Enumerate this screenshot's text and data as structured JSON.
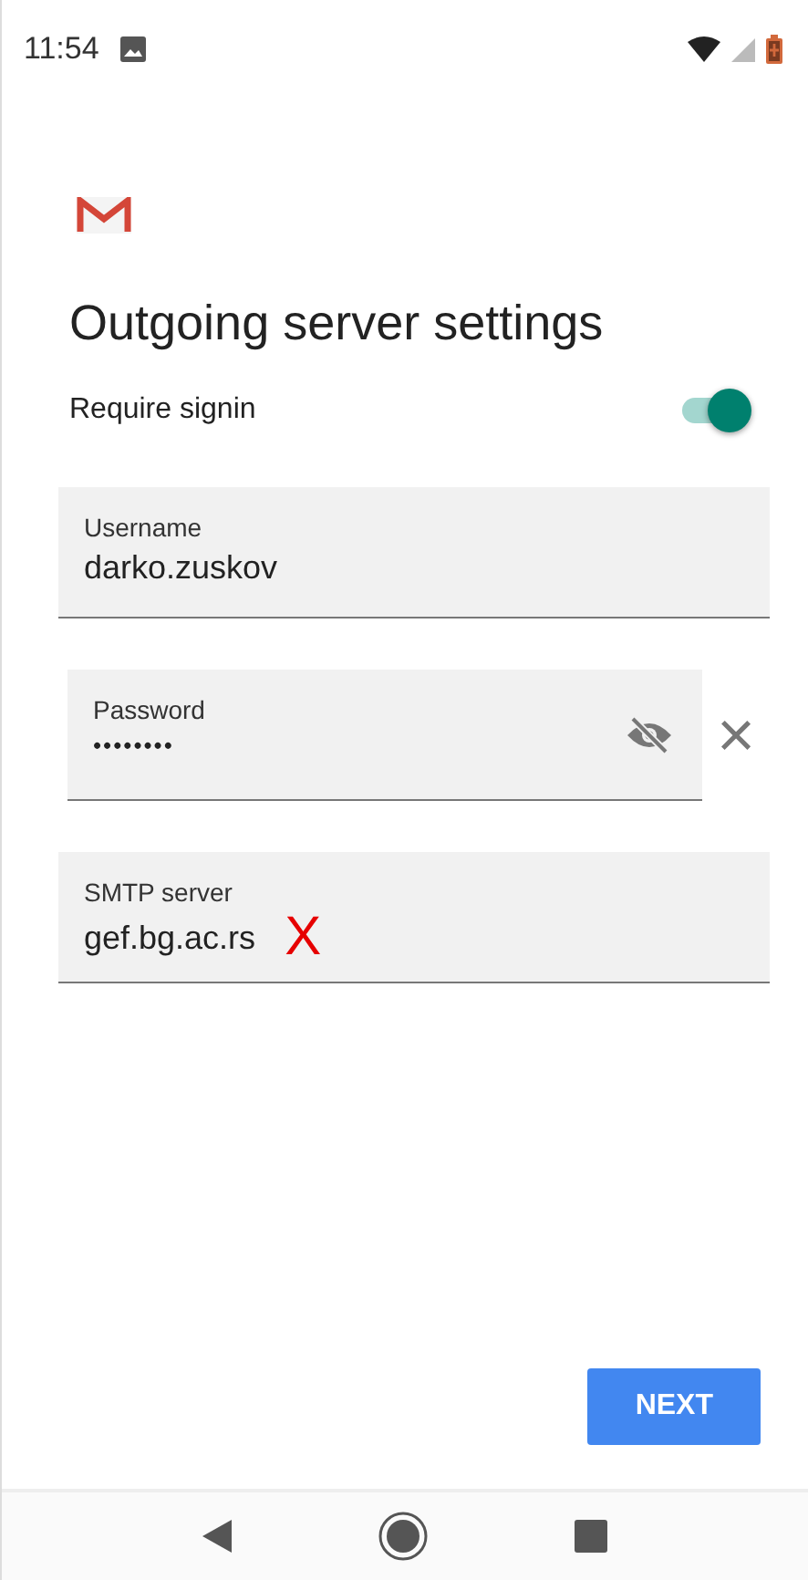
{
  "status_bar": {
    "time": "11:54"
  },
  "title": "Outgoing server settings",
  "toggle": {
    "label": "Require signin",
    "on": true
  },
  "fields": [
    {
      "kind": "text",
      "label": "Username",
      "value": "darko.zuskov"
    },
    {
      "kind": "password",
      "label": "Password",
      "value": "••••••••",
      "side_mark": "×"
    },
    {
      "kind": "text",
      "label": "SMTP server",
      "value": "gef.bg.ac.rs",
      "inline_mark": "X"
    }
  ],
  "buttons": [
    {
      "label": "NEXT"
    }
  ]
}
